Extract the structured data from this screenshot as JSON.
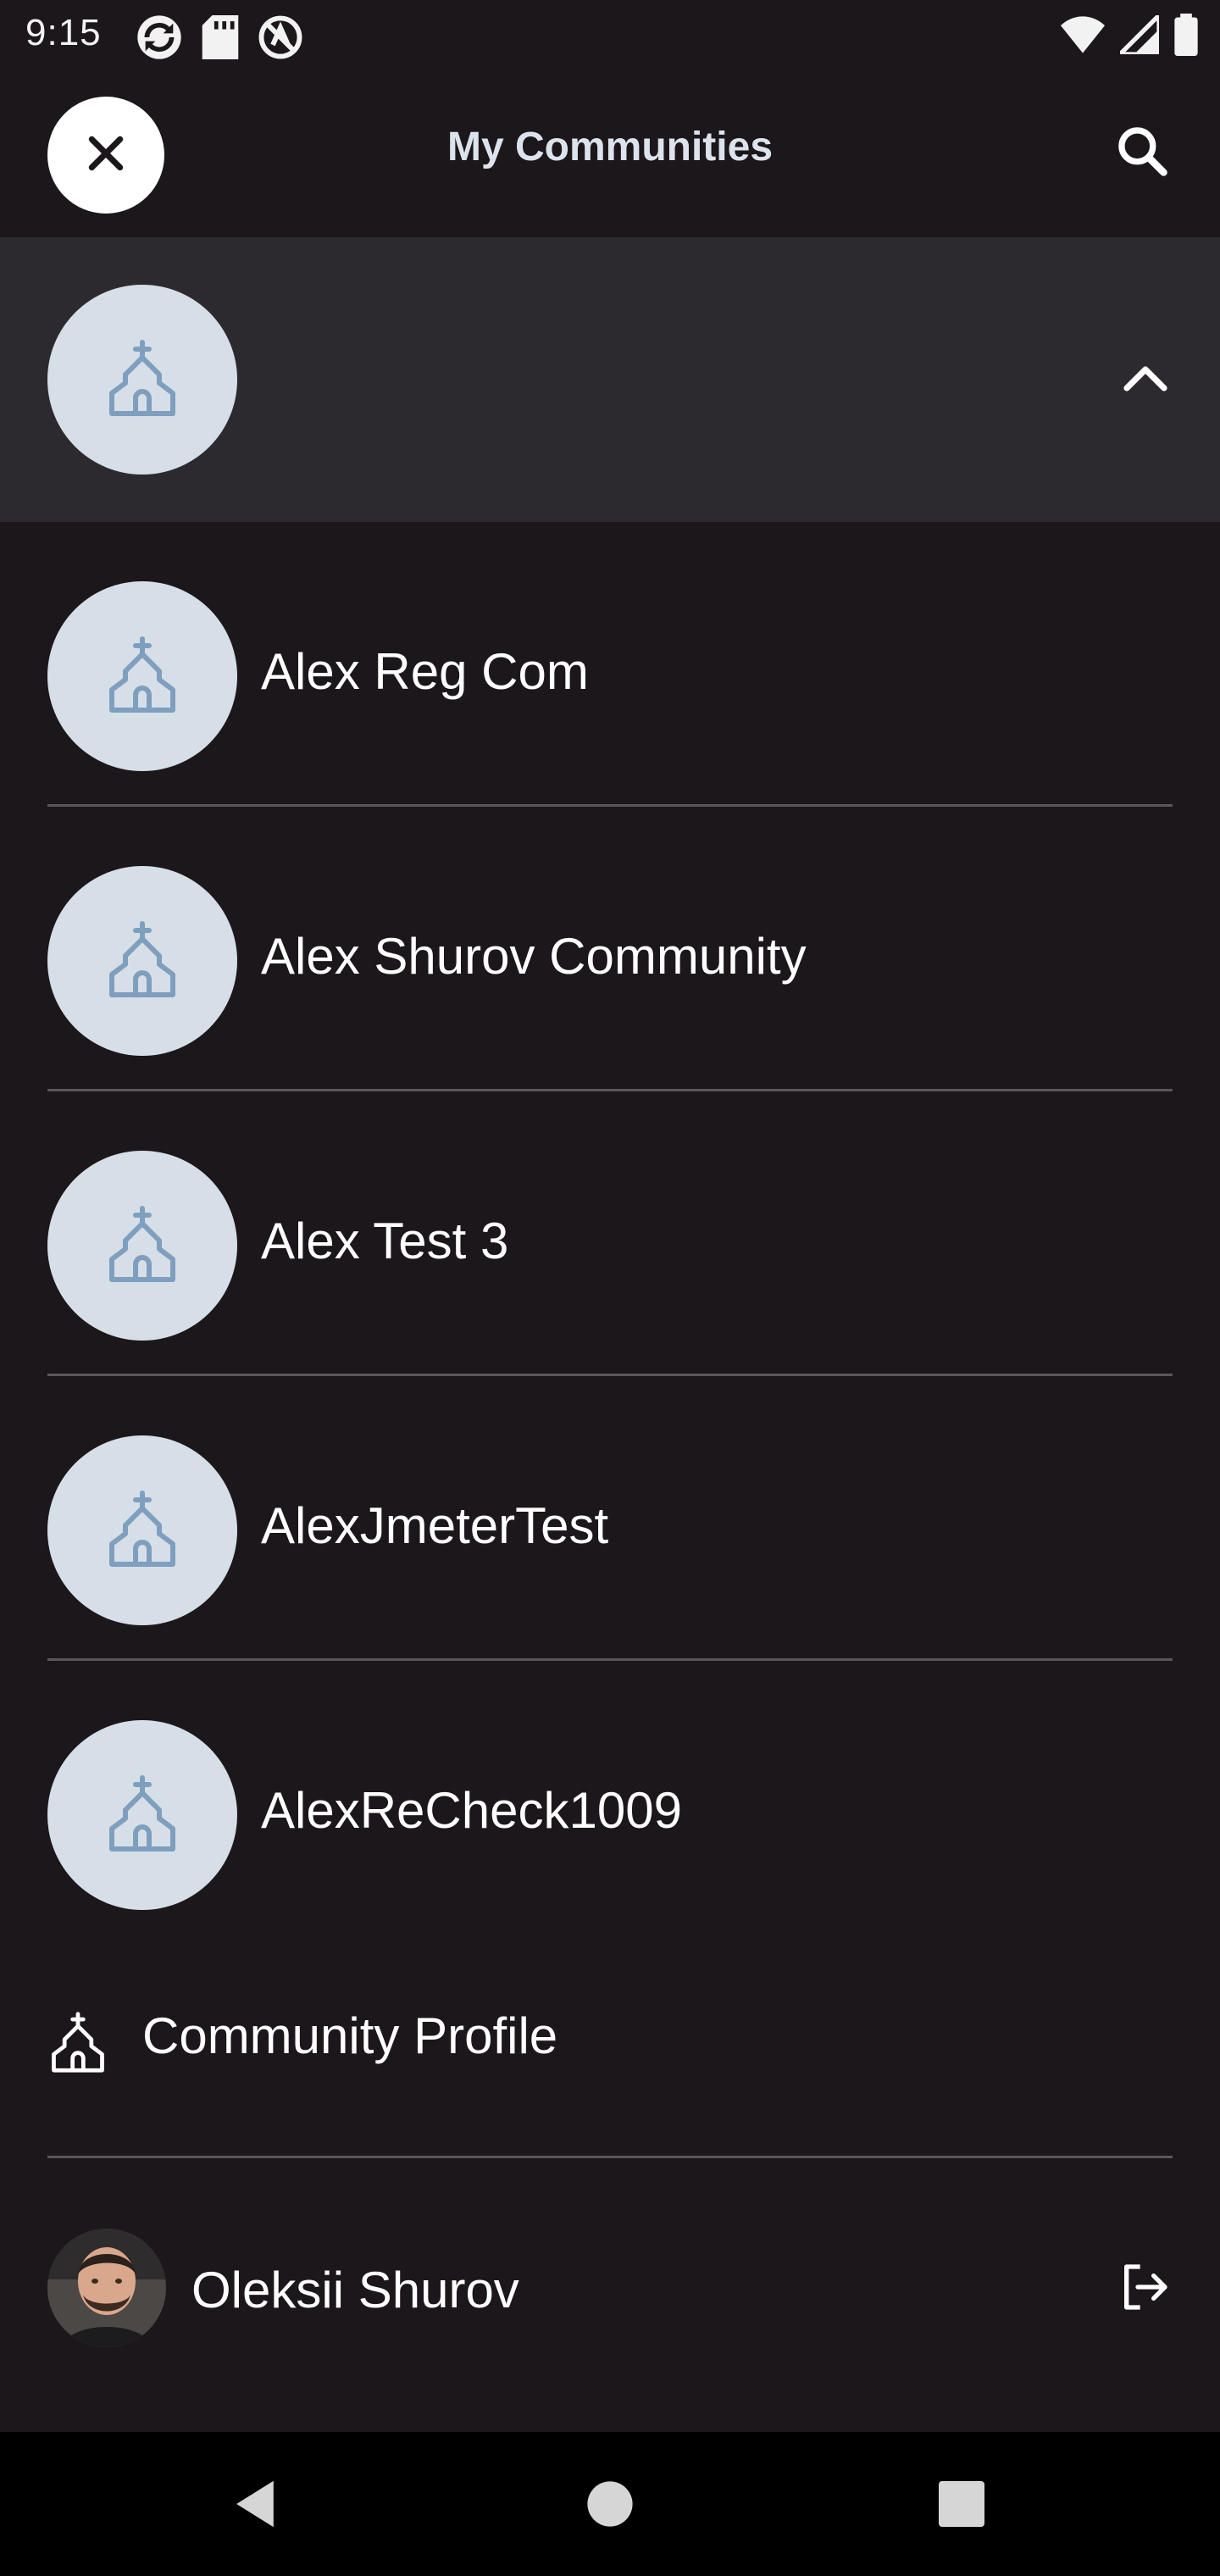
{
  "status_bar": {
    "time": "9:15"
  },
  "header": {
    "title": "My Communities",
    "close_icon": "close-icon",
    "search_icon": "search-icon"
  },
  "current_community": {
    "name": "",
    "icon": "church-icon",
    "toggle_icon": "chevron-up-icon"
  },
  "communities": [
    {
      "name": "Alex Reg Com"
    },
    {
      "name": "Alex Shurov Community"
    },
    {
      "name": "Alex Test 3"
    },
    {
      "name": "AlexJmeterTest"
    },
    {
      "name": "AlexReCheck1009"
    }
  ],
  "community_profile": {
    "label": "Community Profile",
    "icon": "church-outline-icon"
  },
  "user": {
    "name": "Oleksii Shurov",
    "logout_icon": "logout-icon"
  },
  "colors": {
    "background": "#1c171b",
    "selected_row": "#2d2a2f",
    "avatar_bg": "#d6dfe8",
    "avatar_icon": "#7f9fbe",
    "divider": "#5a575c",
    "title": "#dde3ec"
  }
}
